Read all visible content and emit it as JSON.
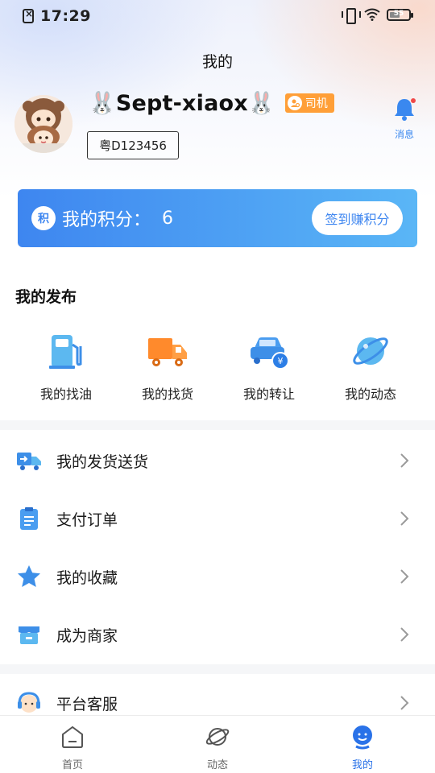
{
  "status_bar": {
    "time": "17:29",
    "battery": "55",
    "battery_fraction": 0.55
  },
  "header": {
    "title": "我的"
  },
  "profile": {
    "username": "🐰Sept-xiaox🐰",
    "role": "司机",
    "plate": "粤D123456",
    "message_label": "消息"
  },
  "points": {
    "label": "我的积分：",
    "value": "6",
    "icon_char": "积",
    "checkin_label": "签到赚积分"
  },
  "publish": {
    "title": "我的发布",
    "items": [
      {
        "label": "我的找油",
        "icon": "fuel-pump-icon"
      },
      {
        "label": "我的找货",
        "icon": "truck-icon"
      },
      {
        "label": "我的转让",
        "icon": "car-transfer-icon"
      },
      {
        "label": "我的动态",
        "icon": "planet-icon"
      }
    ]
  },
  "menu": {
    "items": [
      {
        "label": "我的发货送货",
        "icon": "delivery-truck-icon"
      },
      {
        "label": "支付订单",
        "icon": "clipboard-icon"
      },
      {
        "label": "我的收藏",
        "icon": "star-icon"
      },
      {
        "label": "成为商家",
        "icon": "store-icon"
      },
      {
        "label": "平台客服",
        "icon": "customer-service-icon"
      }
    ]
  },
  "tabbar": {
    "items": [
      {
        "label": "首页",
        "icon": "home-icon",
        "active": false
      },
      {
        "label": "动态",
        "icon": "planet-icon",
        "active": false
      },
      {
        "label": "我的",
        "icon": "user-icon",
        "active": true
      }
    ]
  },
  "colors": {
    "accent": "#3e86f0",
    "badge": "#ff9f38",
    "active_tab": "#2a72e8"
  }
}
